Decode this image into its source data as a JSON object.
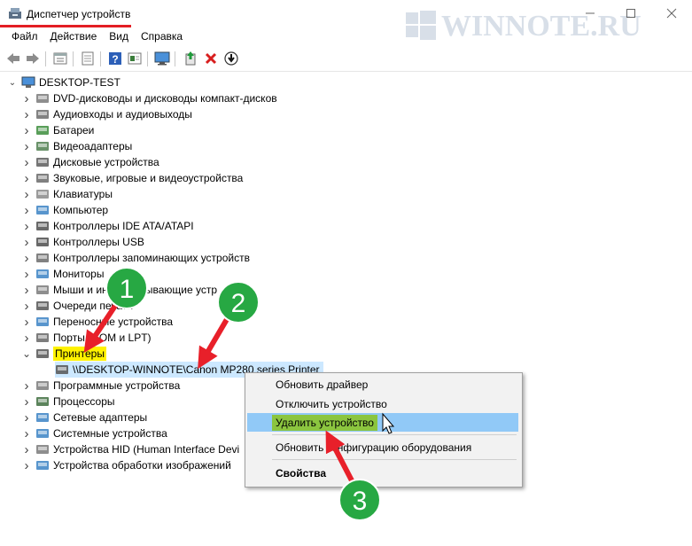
{
  "window": {
    "title": "Диспетчер устройств",
    "watermark": "WINNOTE.RU",
    "controls": [
      "minimize-icon",
      "maximize-icon",
      "close-icon"
    ]
  },
  "menu": [
    "Файл",
    "Действие",
    "Вид",
    "Справка"
  ],
  "toolbar": [
    "back-arrow-icon",
    "forward-arrow-icon",
    "properties-panel-icon",
    "document-icon",
    "help-icon",
    "view-icon",
    "monitor-icon",
    "update-driver-icon",
    "remove-icon",
    "download-icon"
  ],
  "tree": {
    "root": "DESKTOP-TEST",
    "items": [
      {
        "label": "DVD-дисководы и дисководы компакт-дисков",
        "icon": "dvd-icon"
      },
      {
        "label": "Аудиовходы и аудиовыходы",
        "icon": "speaker-icon"
      },
      {
        "label": "Батареи",
        "icon": "battery-icon"
      },
      {
        "label": "Видеоадаптеры",
        "icon": "display-adapter-icon"
      },
      {
        "label": "Дисковые устройства",
        "icon": "disk-icon"
      },
      {
        "label": "Звуковые, игровые и видеоустройства",
        "icon": "sound-icon"
      },
      {
        "label": "Клавиатуры",
        "icon": "keyboard-icon"
      },
      {
        "label": "Компьютер",
        "icon": "computer-icon"
      },
      {
        "label": "Контроллеры IDE ATA/ATAPI",
        "icon": "ide-icon"
      },
      {
        "label": "Контроллеры USB",
        "icon": "usb-icon"
      },
      {
        "label": "Контроллеры запоминающих устройств",
        "icon": "storage-controller-icon"
      },
      {
        "label": "Мониторы",
        "icon": "monitor-icon"
      },
      {
        "label": "Мыши и иные указывающие устр",
        "icon": "mouse-icon"
      },
      {
        "label": "Очереди печати",
        "icon": "print-queue-icon"
      },
      {
        "label": "Переносные устройства",
        "icon": "portable-device-icon"
      },
      {
        "label": "Порты (COM и LPT)",
        "icon": "port-icon"
      },
      {
        "label": "Принтеры",
        "icon": "printer-icon",
        "expanded": true
      },
      {
        "label": "\\\\DESKTOP-WINNOTE\\Canon MP280 series Printer",
        "icon": "printer-icon",
        "child": true,
        "selected": true
      },
      {
        "label": "Программные устройства",
        "icon": "software-device-icon"
      },
      {
        "label": "Процессоры",
        "icon": "cpu-icon"
      },
      {
        "label": "Сетевые адаптеры",
        "icon": "network-adapter-icon"
      },
      {
        "label": "Системные устройства",
        "icon": "system-device-icon"
      },
      {
        "label": "Устройства HID (Human Interface Devi",
        "icon": "hid-icon"
      },
      {
        "label": "Устройства обработки изображений",
        "icon": "camera-icon"
      }
    ]
  },
  "context_menu": {
    "items": [
      {
        "label": "Обновить драйвер"
      },
      {
        "label": "Отключить устройство"
      },
      {
        "label": "Удалить устройство",
        "hover": true
      },
      {
        "label": "Обновить конфигурацию оборудования"
      },
      {
        "label": "Свойства",
        "bold": true
      }
    ]
  },
  "annotations": {
    "numbers": [
      "1",
      "2",
      "3"
    ],
    "bubble_color": "#27a843",
    "arrow_color": "#e8202a"
  }
}
